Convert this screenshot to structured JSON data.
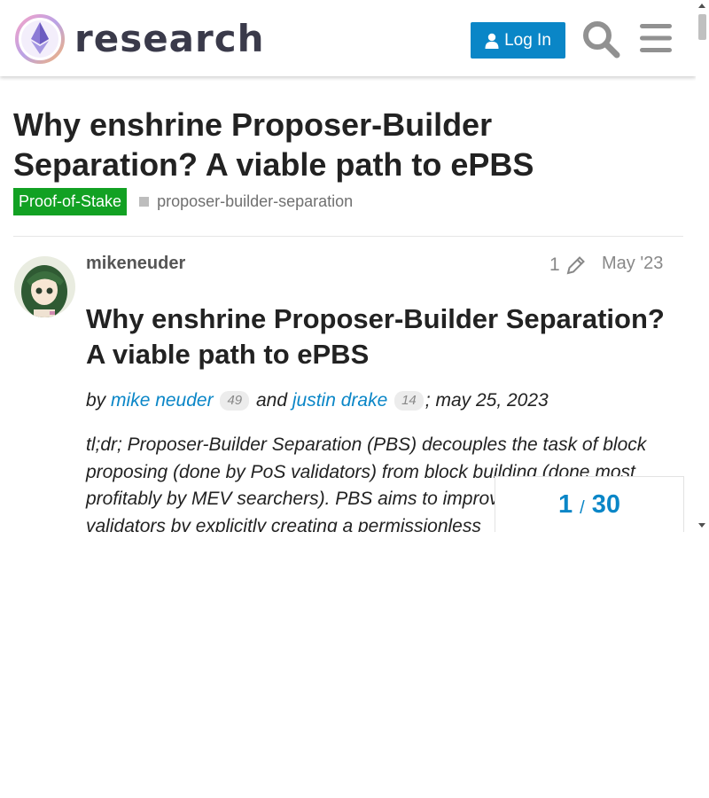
{
  "header": {
    "logo_text": "research",
    "login_label": "Log In",
    "search_icon": "search-icon",
    "menu_icon": "hamburger-menu-icon"
  },
  "topic": {
    "title": "Why enshrine Proposer-Builder Separation? A viable path to ePBS",
    "category": "Proof-of-Stake",
    "category_color": "#12a123",
    "tag": "proposer-builder-separation"
  },
  "post": {
    "username": "mikeneuder",
    "edit_count": "1",
    "date": "May '23",
    "heading": "Why enshrine Proposer-Builder Separation? A viable path to ePBS",
    "byline": {
      "by": "by",
      "author1": "mike neuder",
      "author1_count": "49",
      "and": "and",
      "author2": "justin drake",
      "author2_count": "14",
      "date": "; may 25, 2023"
    },
    "tldr": "tl;dr; Proposer-Builder Separation (PBS) decouples the task of block proposing (done by PoS validators) from block building (done most profitably by MEV searchers). PBS aims to improve access to MEV for validators by explicitly creating a permissionless"
  },
  "timeline": {
    "current": "1",
    "separator": "/",
    "total": "30"
  },
  "colors": {
    "accent": "#0a86c7",
    "text": "#222222"
  }
}
